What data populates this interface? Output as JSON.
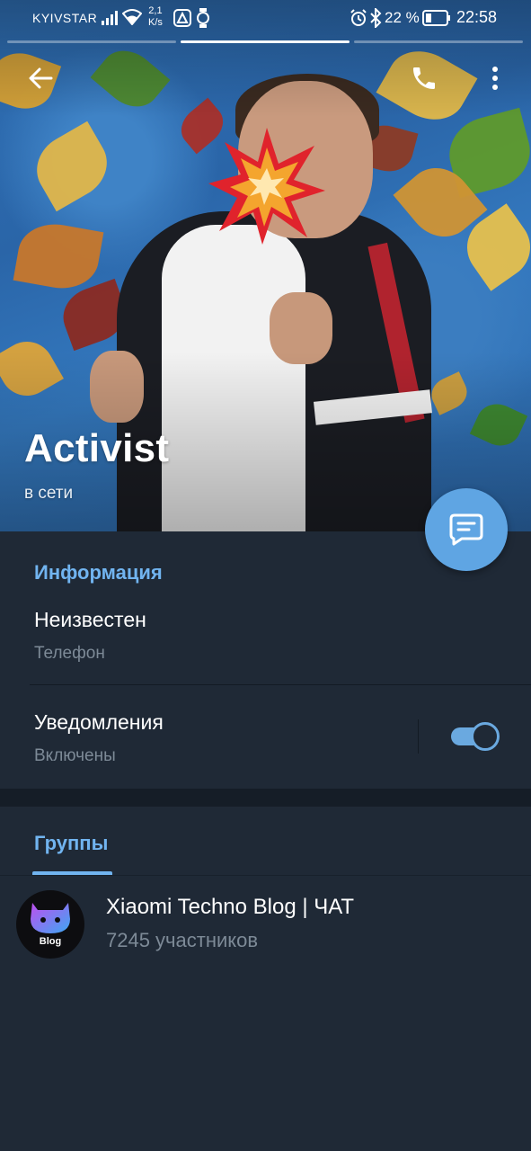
{
  "status_bar": {
    "carrier": "KYIVSTAR",
    "speed_value": "2,1",
    "speed_unit": "K/s",
    "battery": "22 %",
    "time": "22:58"
  },
  "profile": {
    "name": "Activist",
    "status": "в сети"
  },
  "info": {
    "title": "Информация",
    "phone_value": "Неизвестен",
    "phone_label": "Телефон",
    "notifications_label": "Уведомления",
    "notifications_state": "Включены",
    "notifications_on": true
  },
  "groups": {
    "tab_title": "Группы",
    "items": [
      {
        "name": "Xiaomi Techno Blog | ЧАТ",
        "members": "7245 участников",
        "avatar_text": "Blog"
      }
    ]
  },
  "colors": {
    "accent": "#71b4f0",
    "fab": "#5fa5e3",
    "background": "#1f2936"
  },
  "icons": {
    "back": "arrow-left-icon",
    "call": "phone-icon",
    "menu": "more-vert-icon",
    "fab": "message-icon"
  }
}
